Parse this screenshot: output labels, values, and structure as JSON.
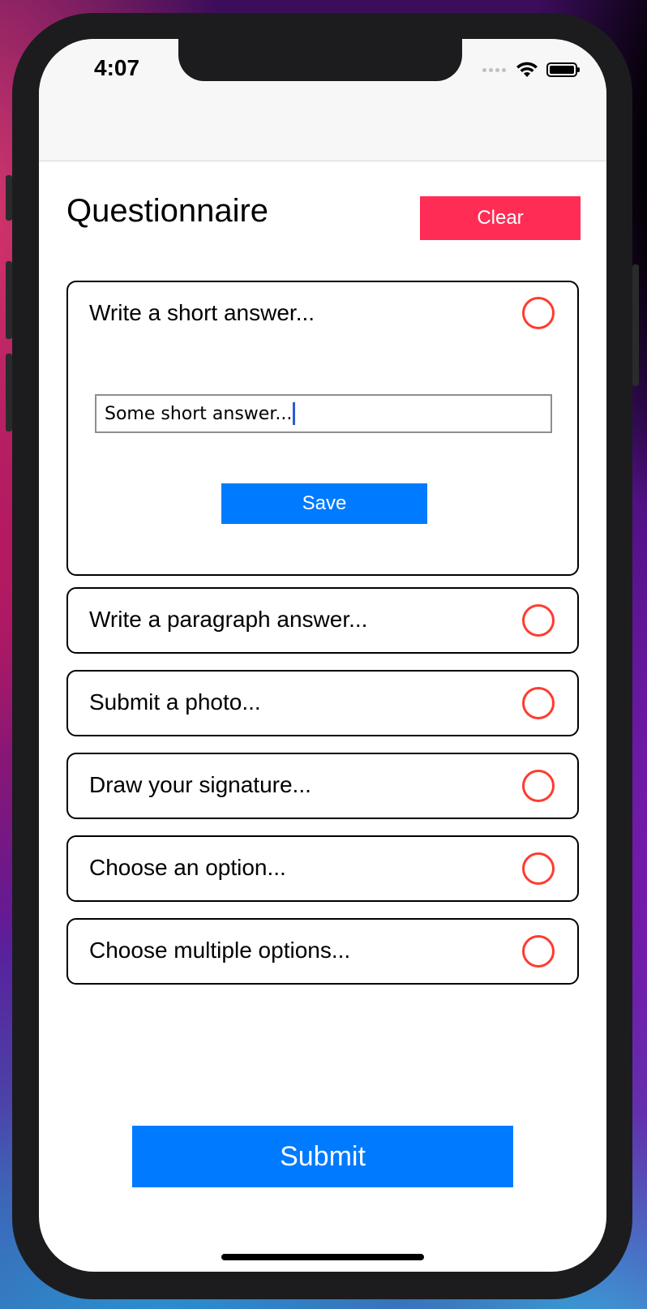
{
  "status_bar": {
    "time": "4:07",
    "icons": [
      "signal-dots-icon",
      "wifi-icon",
      "battery-icon"
    ]
  },
  "header": {
    "title": "Questionnaire",
    "clear_label": "Clear"
  },
  "colors": {
    "clear_button": "#ff2d55",
    "primary_button": "#007aff",
    "status_circle": "#ff3b30"
  },
  "questions": [
    {
      "label": "Write a short answer...",
      "expanded": true,
      "input_value": "Some short answer...",
      "save_label": "Save",
      "status_icon": "empty-circle-icon"
    },
    {
      "label": "Write a paragraph answer...",
      "status_icon": "empty-circle-icon"
    },
    {
      "label": "Submit a photo...",
      "status_icon": "empty-circle-icon"
    },
    {
      "label": "Draw your signature...",
      "status_icon": "empty-circle-icon"
    },
    {
      "label": "Choose an option...",
      "status_icon": "empty-circle-icon"
    },
    {
      "label": "Choose multiple options...",
      "status_icon": "empty-circle-icon"
    }
  ],
  "footer": {
    "submit_label": "Submit"
  }
}
